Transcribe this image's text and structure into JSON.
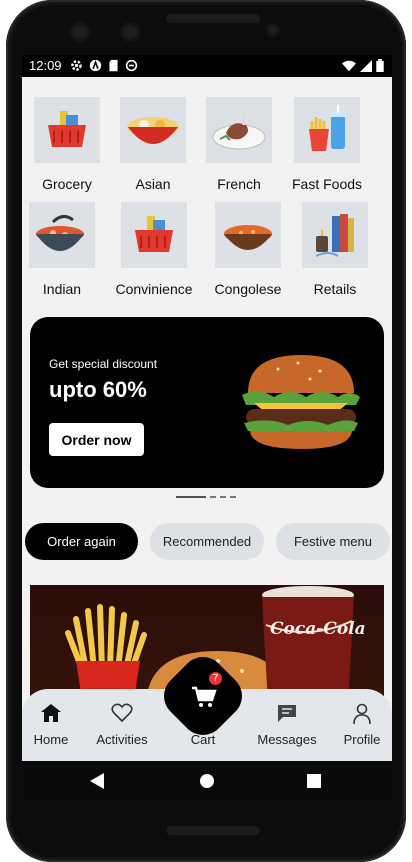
{
  "status_bar": {
    "time": "12:09"
  },
  "categories": [
    {
      "label": "Grocery",
      "icon": "grocery-basket-icon"
    },
    {
      "label": "Asian",
      "icon": "ramen-bowl-icon"
    },
    {
      "label": "French",
      "icon": "steak-plate-icon"
    },
    {
      "label": "Fast Foods",
      "icon": "fries-drink-icon"
    },
    {
      "label": "Indian",
      "icon": "curry-pot-icon"
    },
    {
      "label": "Convinience",
      "icon": "grocery-basket-icon"
    },
    {
      "label": "Congolese",
      "icon": "rice-bowl-icon"
    },
    {
      "label": "Retails",
      "icon": "books-candle-icon"
    }
  ],
  "banner": {
    "subtitle": "Get special discount",
    "headline": "upto 60%",
    "button": "Order now",
    "slides": 4,
    "active_slide": 1
  },
  "chips": [
    {
      "label": "Order again",
      "active": true
    },
    {
      "label": "Recommended",
      "active": false
    },
    {
      "label": "Festive menu",
      "active": false
    }
  ],
  "promo": {
    "brand_text": "Coca-Cola"
  },
  "bottom_nav": {
    "home": "Home",
    "activities": "Activities",
    "cart": "Cart",
    "cart_count": "7",
    "messages": "Messages",
    "profile": "Profile"
  },
  "colors": {
    "accent": "#000000",
    "badge": "#e33333",
    "background": "#f2f2f2"
  }
}
